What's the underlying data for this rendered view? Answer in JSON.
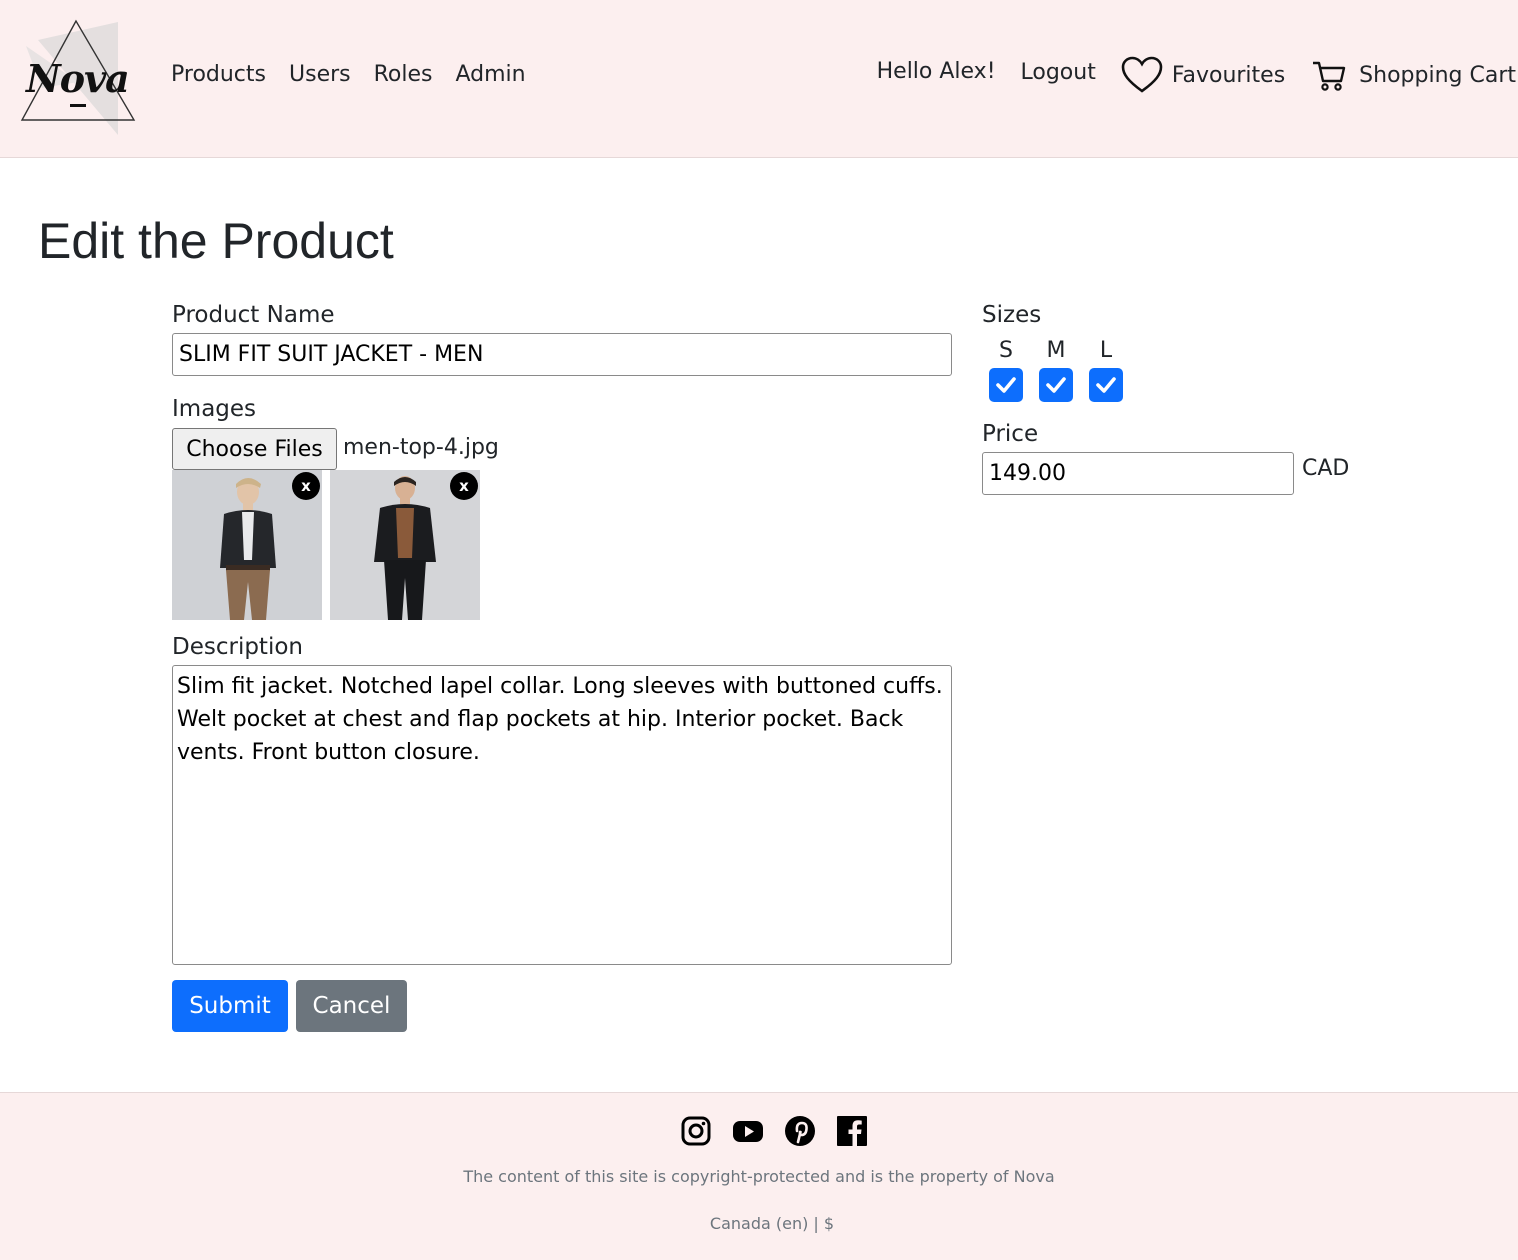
{
  "brand": {
    "logo_text": "Nova"
  },
  "nav": {
    "left": [
      "Products",
      "Users",
      "Roles",
      "Admin"
    ],
    "greeting": "Hello Alex!",
    "logout": "Logout",
    "favourites": "Favourites",
    "cart": "Shopping Cart"
  },
  "page": {
    "title": "Edit the Product"
  },
  "form": {
    "name_label": "Product Name",
    "name_value": "SLIM FIT SUIT JACKET - MEN",
    "images_label": "Images",
    "choose_files": "Choose Files",
    "file_name": "men-top-4.jpg",
    "remove_label": "x",
    "description_label": "Description",
    "description_value": "Slim fit jacket. Notched lapel collar. Long sleeves with buttoned cuffs. Welt pocket at chest and flap pockets at hip. Interior pocket. Back vents. Front button closure.",
    "submit": "Submit",
    "cancel": "Cancel",
    "sizes_label": "Sizes",
    "sizes": [
      {
        "label": "S",
        "checked": true
      },
      {
        "label": "M",
        "checked": true
      },
      {
        "label": "L",
        "checked": true
      }
    ],
    "price_label": "Price",
    "price_value": "149.00",
    "currency": "CAD"
  },
  "footer": {
    "socials": [
      "instagram-icon",
      "youtube-icon",
      "pinterest-icon",
      "facebook-icon"
    ],
    "copyright": "The content of this site is copyright-protected and is the property of Nova",
    "locale": "Canada (en) | $"
  },
  "colors": {
    "header_bg": "#fcefef",
    "primary": "#0d6efd",
    "secondary": "#6c757d"
  }
}
